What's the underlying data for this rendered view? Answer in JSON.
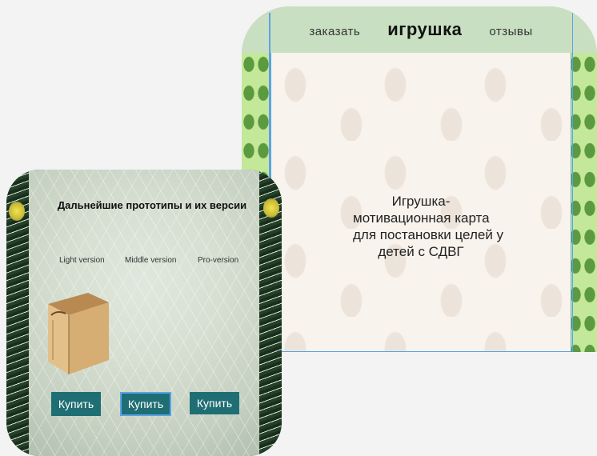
{
  "landing": {
    "nav": {
      "order_link": "заказать",
      "brand": "игрушка",
      "reviews_link": "отзывы"
    },
    "hero_lines": [
      "Игрушка-",
      "мотивационная карта",
      "для постановки целей у",
      "детей с СДВГ"
    ]
  },
  "prototypes": {
    "title": "Дальнейшие прототипы и их версии",
    "versions": [
      "Light version",
      "Middle version",
      "Pro-version"
    ],
    "buy_buttons": [
      "Купить",
      "Купить",
      "Купить"
    ]
  },
  "colors": {
    "nav_background": "#c9dfc2",
    "hero_background": "#f8f3ec",
    "cactus_pattern": "#c4e89a",
    "button_teal": "#1f6e74",
    "selection_blue": "#5aa3e6"
  },
  "icons": {
    "cactus_pattern": "cactus-pattern-icon",
    "product_box": "wooden-box-icon"
  }
}
